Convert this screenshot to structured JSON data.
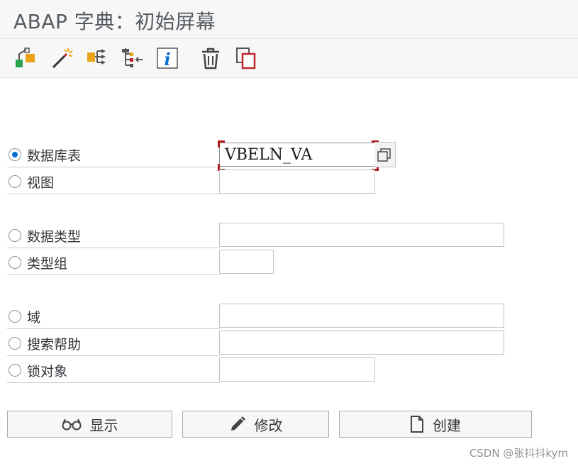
{
  "window": {
    "title": "ABAP 字典：初始屏幕"
  },
  "toolbar": {
    "icons": [
      "object-navigation-icon",
      "magic-wand-icon",
      "where-used-icon",
      "hierarchy-icon",
      "info-icon",
      "trash-icon",
      "copy-icon"
    ]
  },
  "form": {
    "options": [
      {
        "label": "数据库表",
        "selected": true,
        "value": "VBELN_VA"
      },
      {
        "label": "视图",
        "selected": false,
        "value": ""
      },
      {
        "label": "数据类型",
        "selected": false,
        "value": ""
      },
      {
        "label": "类型组",
        "selected": false,
        "value": ""
      },
      {
        "label": "域",
        "selected": false,
        "value": ""
      },
      {
        "label": "搜索帮助",
        "selected": false,
        "value": ""
      },
      {
        "label": "锁对象",
        "selected": false,
        "value": ""
      }
    ]
  },
  "buttons": {
    "display": "显示",
    "change": "修改",
    "create": "创建"
  },
  "colors": {
    "selected_radio": "#0a6ed1",
    "focus_corner": "#b01c1c",
    "info_icon": "#0a6ed1",
    "copy_icon_accent": "#c0262d"
  },
  "watermark": "CSDN @张抖抖kym"
}
